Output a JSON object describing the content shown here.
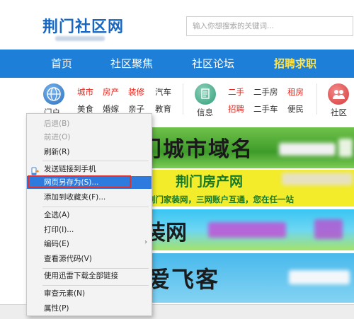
{
  "header": {
    "logo": "荆门社区网",
    "search_placeholder": "输入你想搜索的关键词..."
  },
  "nav": {
    "items": [
      "首页",
      "社区聚焦",
      "社区论坛",
      "招聘求职"
    ]
  },
  "categories": {
    "group1_label": "门户",
    "group1_row1": [
      "城市",
      "房产",
      "装修",
      "汽车"
    ],
    "group1_row2": [
      "美食",
      "婚嫁",
      "亲子",
      "教育"
    ],
    "group2_label": "信息",
    "group2_row1": [
      "二手",
      "二手房",
      "租房"
    ],
    "group2_row2": [
      "招聘",
      "二手车",
      "便民"
    ],
    "group3_label": "社区"
  },
  "banners": {
    "b1": "门城市域名",
    "b2_title": "荆门房产网",
    "b2_sub": "荆门家装网，三网账户互通，您在任一站",
    "b3": "装网",
    "b4": "爱飞客"
  },
  "context_menu": {
    "back": "后退(B)",
    "forward": "前进(O)",
    "refresh": "刷新(R)",
    "send_to_phone": "发送链接到手机",
    "save_as": "网页另存为(S)...",
    "add_favorite": "添加到收藏夹(F)...",
    "select_all": "全选(A)",
    "print": "打印(I)...",
    "encoding": "编码(E)",
    "view_source": "查看源代码(V)",
    "download_all": "使用迅雷下载全部链接",
    "inspect": "审查元素(N)",
    "properties": "属性(P)"
  },
  "colors": {
    "brand_blue": "#1e7fd8",
    "nav_highlight": "#ffe44a",
    "category_red": "#e4261d",
    "menu_highlight": "#2e7be0"
  }
}
